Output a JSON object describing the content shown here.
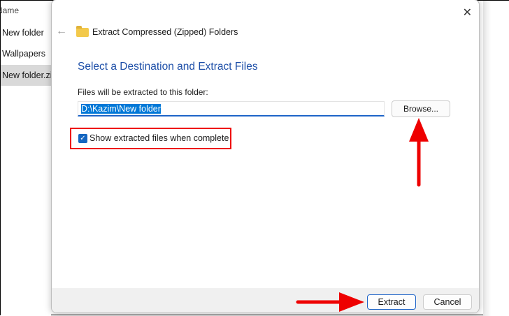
{
  "explorer": {
    "header": "Name",
    "items": [
      "New folder",
      "Wallpapers",
      "New folder.zip"
    ]
  },
  "dialog": {
    "title": "Extract Compressed (Zipped) Folders",
    "heading": "Select a Destination and Extract Files",
    "path_label": "Files will be extracted to this folder:",
    "path_value": "D:\\Kazim\\New folder",
    "browse_label": "Browse...",
    "checkbox_label": "Show extracted files when complete",
    "checkbox_checked": true,
    "extract_label": "Extract",
    "cancel_label": "Cancel",
    "close_glyph": "✕",
    "back_glyph": "←"
  },
  "colors": {
    "accent": "#1e64c8",
    "annotation": "#e00000"
  }
}
